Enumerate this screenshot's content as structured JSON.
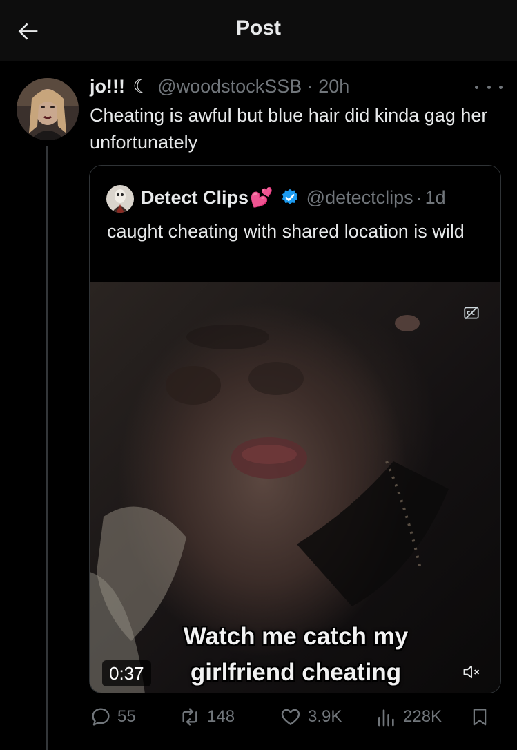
{
  "header": {
    "title": "Post",
    "back_icon": "arrow-left-icon"
  },
  "post": {
    "author_name": "jo!!!",
    "author_emoji": "☾",
    "handle": "@woodstockSSB",
    "separator": "·",
    "time": "20h",
    "text": "Cheating is awful but blue hair did kinda gag her unfortunately",
    "more_icon": "more-dots-icon"
  },
  "quote": {
    "author_name": "Detect Clips",
    "author_emoji": "💕",
    "verified_icon": "verified-badge-icon",
    "handle": "@detectclips",
    "separator": "·",
    "time": "1d",
    "text": "caught cheating with shared location is wild",
    "video": {
      "caption_line1": "Watch me catch my",
      "caption_line2": "girlfriend cheating",
      "duration": "0:37",
      "cc_icon": "captions-off-icon",
      "mute_icon": "volume-muted-icon"
    }
  },
  "actions": {
    "replies": "55",
    "reposts": "148",
    "likes": "3.9K",
    "views": "228K",
    "bookmark_icon": "bookmark-icon"
  },
  "colors": {
    "background": "#000000",
    "header_bg": "#0d0d0d",
    "text_primary": "#e7e9ea",
    "text_muted": "#71767b",
    "border": "#2f3336",
    "verified_blue": "#1d9bf0"
  }
}
